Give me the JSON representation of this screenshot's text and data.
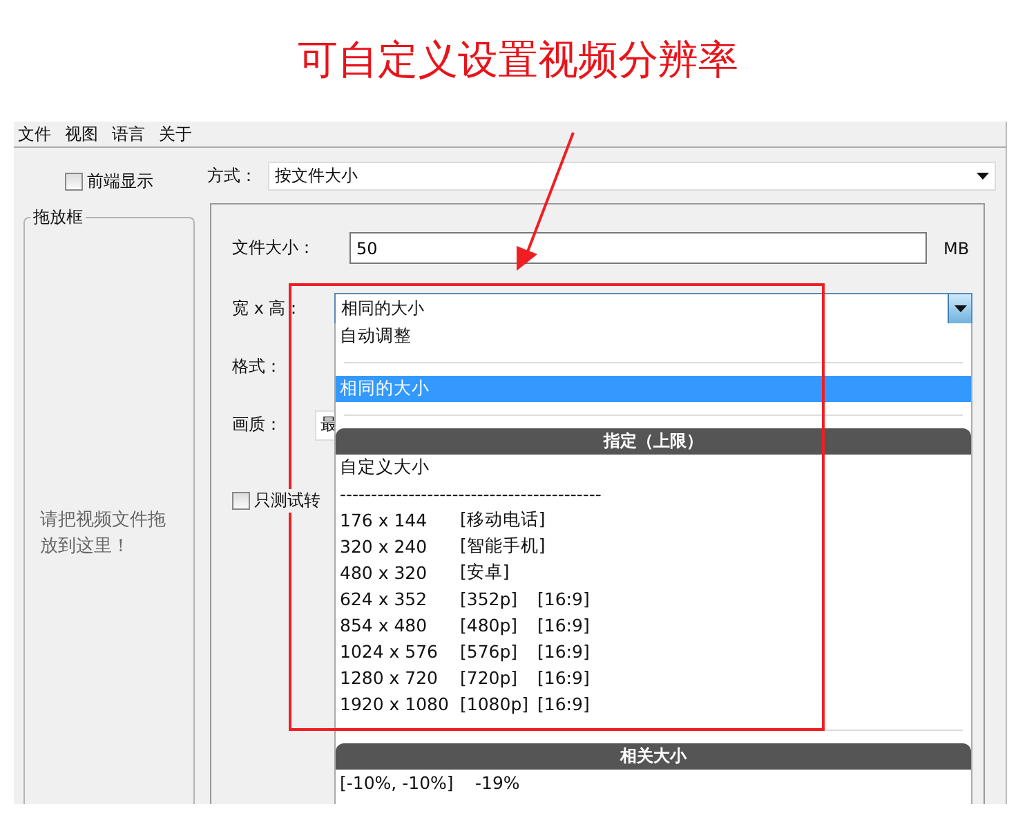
{
  "annotation": {
    "title": "可自定义设置视频分辨率",
    "highlight": true
  },
  "menu": [
    "文件",
    "视图",
    "语言",
    "关于"
  ],
  "sidebar": {
    "always_on_top": {
      "label": "前端显示",
      "checked": false
    },
    "drop_box": {
      "title": "拖放框",
      "hint": "请把视频文件拖放到这里！"
    }
  },
  "mode": {
    "label": "方式：",
    "value": "按文件大小"
  },
  "settings": {
    "file_size": {
      "label": "文件大小：",
      "value": "50",
      "unit": "MB"
    },
    "dimensions": {
      "label": "宽 x 高：",
      "value": "相同的大小",
      "expanded": true
    },
    "format": {
      "label": "格式："
    },
    "quality": {
      "label": "画质：",
      "value": "最"
    },
    "test_only": {
      "label": "只测试转",
      "checked": false
    }
  },
  "dropdown": {
    "items": [
      {
        "kind": "option",
        "label": "自动调整",
        "selected": false
      },
      {
        "kind": "separator"
      },
      {
        "kind": "option",
        "label": "相同的大小",
        "selected": true
      },
      {
        "kind": "separator"
      },
      {
        "kind": "header",
        "label": "指定（上限）"
      },
      {
        "kind": "option",
        "label": "自定义大小",
        "selected": false
      },
      {
        "kind": "dashes",
        "label": "------------------------------------------"
      },
      {
        "kind": "resolution",
        "size": "176 x 144",
        "tag": "[移动电话]",
        "selected": false
      },
      {
        "kind": "resolution",
        "size": "320 x 240",
        "tag": "[智能手机]",
        "selected": false
      },
      {
        "kind": "resolution",
        "size": "480 x 320",
        "tag": "[安卓]",
        "selected": false
      },
      {
        "kind": "resolution",
        "size": "624 x 352",
        "tag": "[352p]",
        "aspect": "[16:9]",
        "selected": false
      },
      {
        "kind": "resolution",
        "size": "854 x 480",
        "tag": "[480p]",
        "aspect": "[16:9]",
        "selected": false
      },
      {
        "kind": "resolution",
        "size": "1024 x 576",
        "tag": "[576p]",
        "aspect": "[16:9]",
        "selected": false
      },
      {
        "kind": "resolution",
        "size": "1280 x 720",
        "tag": "[720p]",
        "aspect": "[16:9]",
        "selected": false
      },
      {
        "kind": "resolution",
        "size": "1920 x 1080",
        "tag": "[1080p]",
        "aspect": "[16:9]",
        "selected": false
      },
      {
        "kind": "separator"
      },
      {
        "kind": "header",
        "label": "相关大小"
      },
      {
        "kind": "relative",
        "range": "[-10%, -10%]",
        "change": "-19%",
        "selected": false
      }
    ]
  }
}
